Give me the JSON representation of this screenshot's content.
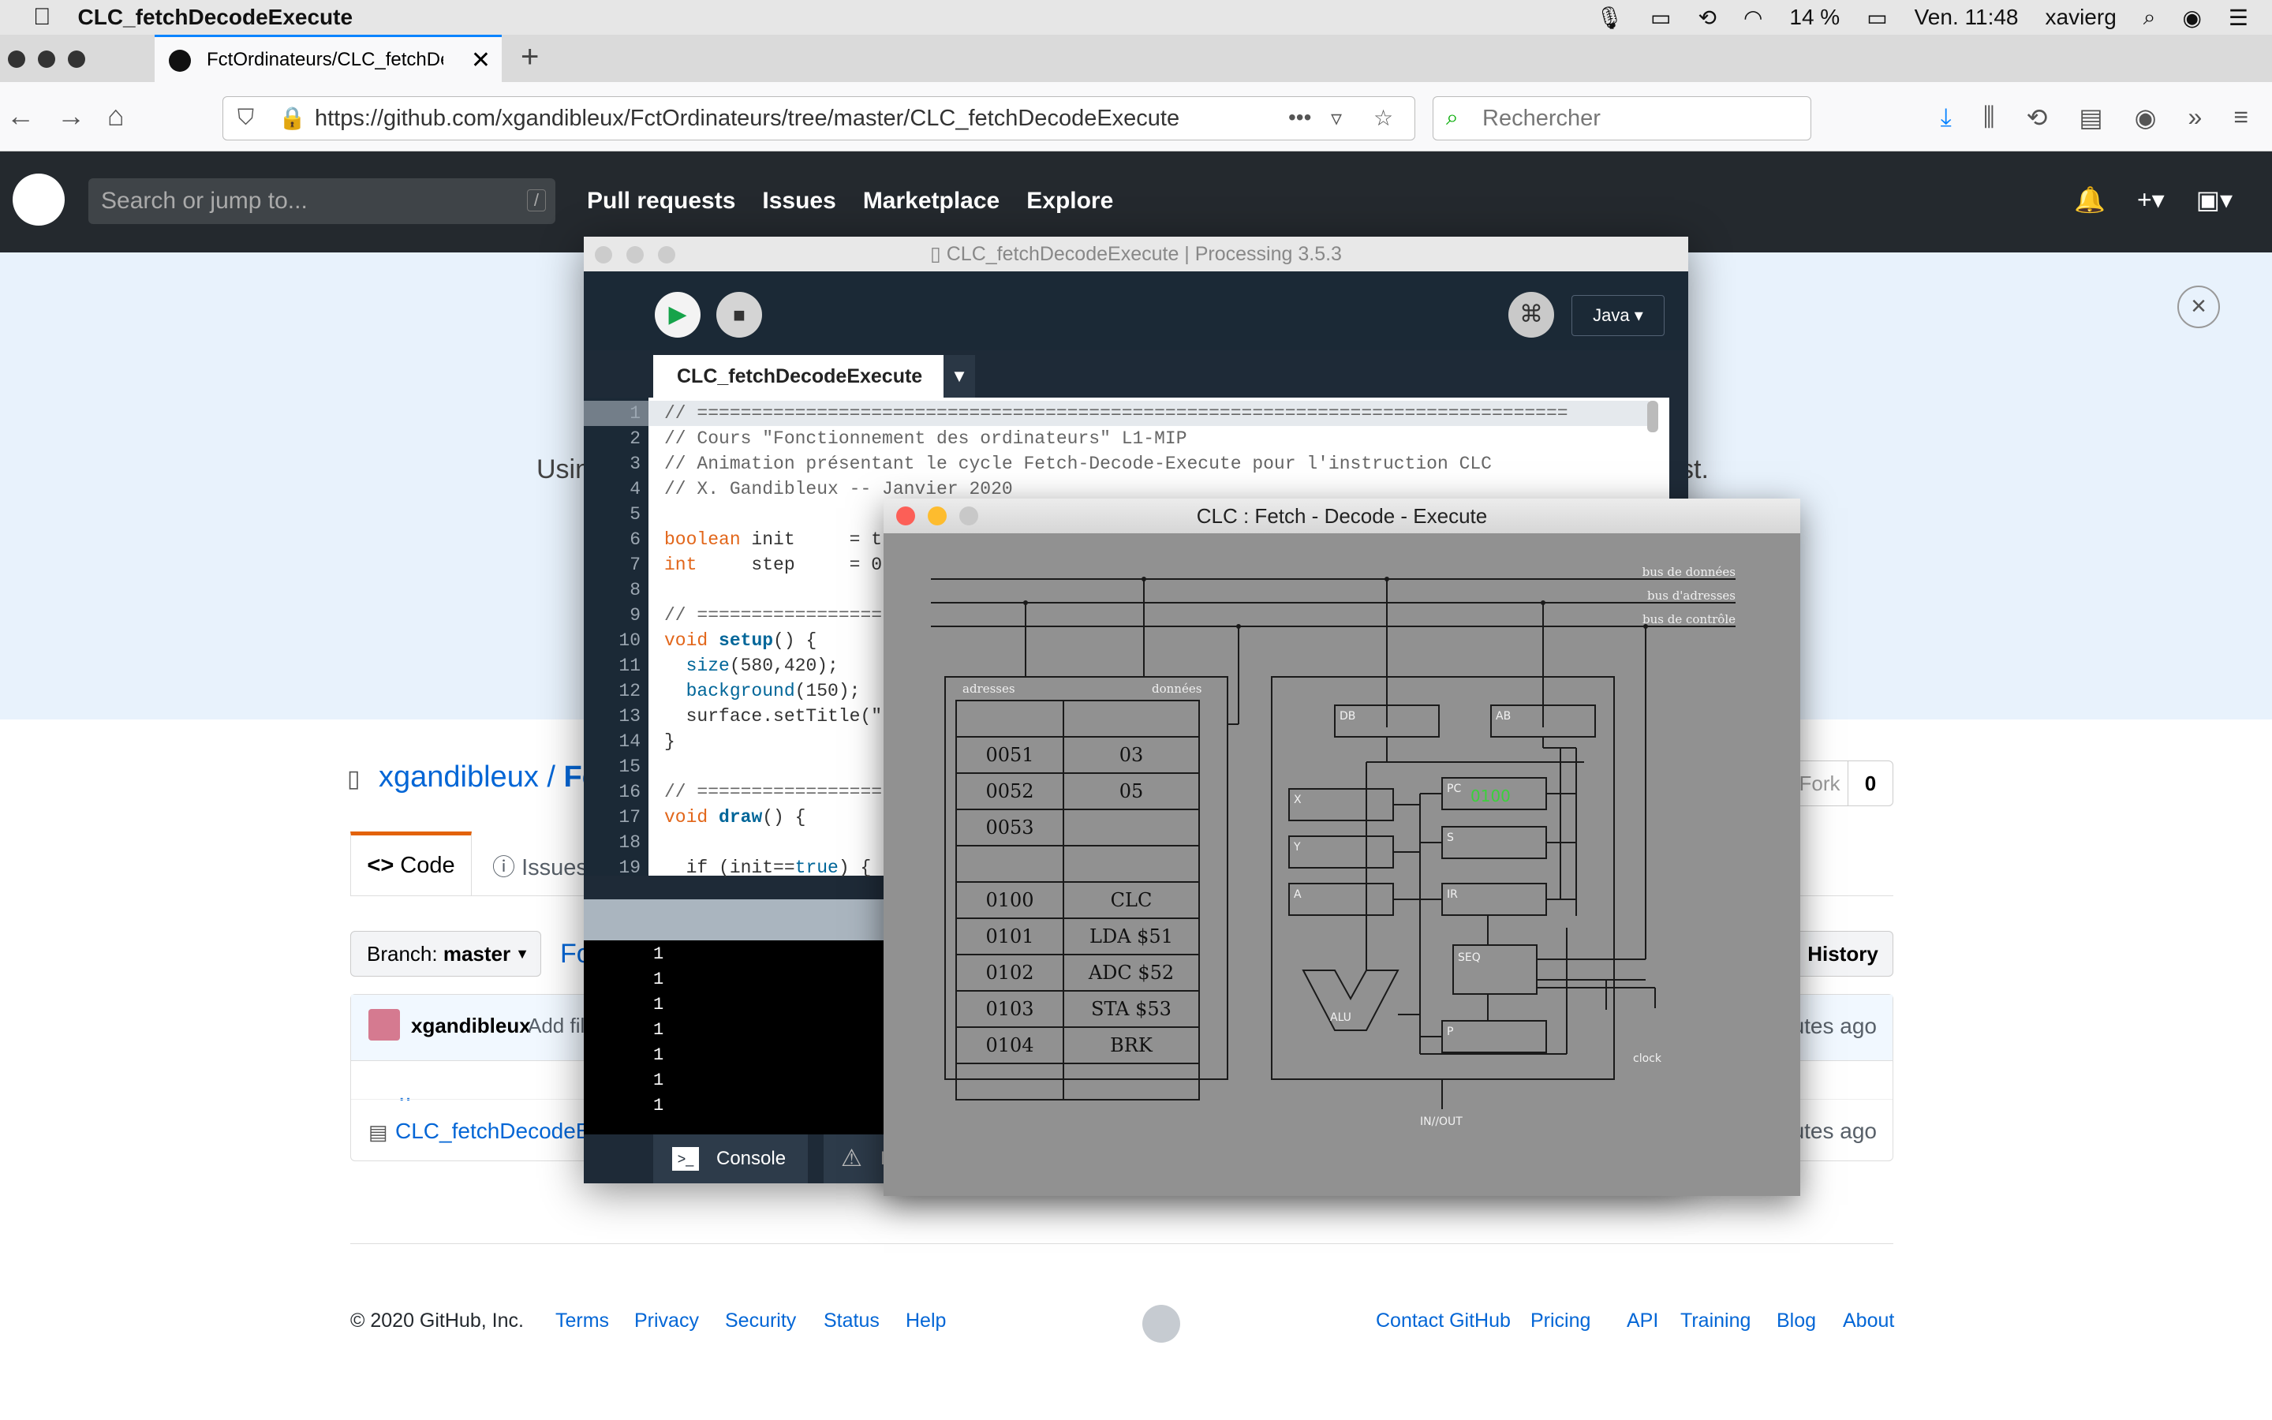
{
  "menubar": {
    "app_name": "CLC_fetchDecodeExecute",
    "battery": "14 %",
    "datetime": "Ven. 11:48",
    "user": "xavierg"
  },
  "browser": {
    "tab_title": "FctOrdinateurs/CLC_fetchDeco",
    "url": "https://github.com/xgandibleux/FctOrdinateurs/tree/master/CLC_fetchDecodeExecute",
    "search_placeholder": "Rechercher",
    "url_more": "•••"
  },
  "github": {
    "search_placeholder": "Search or jump to...",
    "search_shortcut": "/",
    "nav": [
      "Pull requests",
      "Issues",
      "Marketplace",
      "Explore"
    ],
    "flash_text_left": "Usin",
    "flash_text_right": "st.",
    "repo_owner": "xgandibleux",
    "repo_sep": "/",
    "repo_name_partial": "Fc",
    "fork_label": "Fork",
    "fork_count": "0",
    "tab_code": "Code",
    "tab_issues": "Issues",
    "branch_label": "Branch:",
    "branch_name": "master",
    "path_partial": "Fo",
    "history_label": "History",
    "commit_user": "xgandibleux",
    "commit_msg_partial": "Add fil",
    "commit_time_partial": "utes ago",
    "parent_dir": "..",
    "file_name_partial": "CLC_fetchDecodeE",
    "file_time_partial": "utes ago",
    "footer": {
      "copyright": "© 2020 GitHub, Inc.",
      "left_links": [
        "Terms",
        "Privacy",
        "Security",
        "Status",
        "Help"
      ],
      "right_links": [
        "Contact GitHub",
        "Pricing",
        "API",
        "Training",
        "Blog",
        "About"
      ]
    }
  },
  "processing": {
    "window_title": "CLC_fetchDecodeExecute | Processing 3.5.3",
    "mode": "Java ▾",
    "sketch_tab": "CLC_fetchDecodeExecute",
    "code_lines": [
      "// ================================================================================",
      "// Cours \"Fonctionnement des ordinateurs\" L1-MIP",
      "// Animation présentant le cycle Fetch-Decode-Execute pour l'instruction CLC",
      "// X. Gandibleux -- Janvier 2020",
      "",
      "boolean init     = t",
      "int     step     = 0",
      "",
      "// =================",
      "void setup() {",
      "  size(580,420);",
      "  background(150);",
      "  surface.setTitle(\"",
      "}",
      "",
      "// =================",
      "void draw() {",
      "",
      "  if (init==true) {"
    ],
    "console_lines": [
      "1",
      "1",
      "1",
      "1",
      "1",
      "1",
      "1"
    ],
    "console_tab": "Console",
    "errors_tab_partial": "E"
  },
  "sketch": {
    "window_title": "CLC : Fetch - Decode - Execute",
    "bus_labels": [
      "bus de données",
      "bus d'adresses",
      "bus de contrôle"
    ],
    "mem_header_addr": "adresses",
    "mem_header_data": "données",
    "memory_rows": [
      {
        "addr": "",
        "data": ""
      },
      {
        "addr": "0051",
        "data": "03"
      },
      {
        "addr": "0052",
        "data": "05"
      },
      {
        "addr": "0053",
        "data": ""
      },
      {
        "addr": "",
        "data": ""
      },
      {
        "addr": "0100",
        "data": "CLC"
      },
      {
        "addr": "0101",
        "data": "LDA $51"
      },
      {
        "addr": "0102",
        "data": "ADC $52"
      },
      {
        "addr": "0103",
        "data": "STA $53"
      },
      {
        "addr": "0104",
        "data": "BRK"
      },
      {
        "addr": "",
        "data": ""
      }
    ],
    "registers": {
      "db": "DB",
      "ab": "AB",
      "x": "X",
      "y": "Y",
      "a": "A",
      "pc": "PC",
      "pc_value": "0100",
      "s": "S",
      "ir": "IR",
      "seq": "SEQ",
      "p": "P",
      "alu": "ALU",
      "clock": "clock",
      "io": "IN//OUT"
    },
    "colors": {
      "bg": "#919191",
      "line": "#1a1a1a",
      "pc_value": "#3bd13b"
    }
  }
}
